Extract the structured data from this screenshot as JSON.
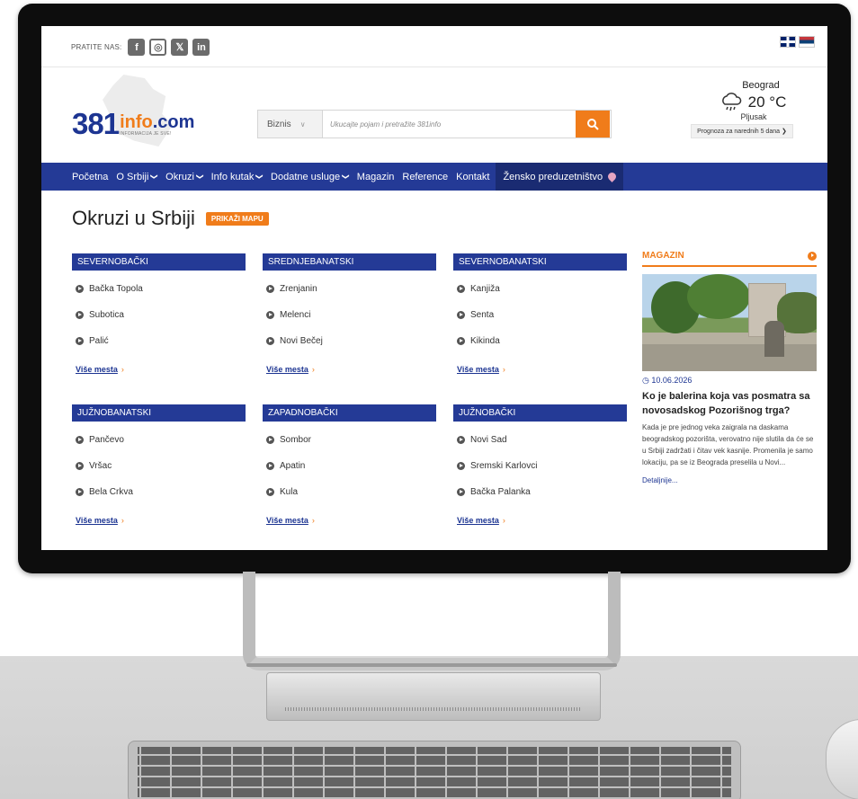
{
  "colors": {
    "brand_blue": "#243a96",
    "accent_orange": "#f07c1a",
    "nav_highlight": "#1a2b72"
  },
  "topbar": {
    "follow_label": "PRATITE NAS:",
    "social_icons": [
      "facebook-icon",
      "instagram-icon",
      "x-icon",
      "linkedin-icon"
    ],
    "languages": [
      "English",
      "Srpski"
    ]
  },
  "header": {
    "logo_number": "381",
    "logo_brand_1": "info",
    "logo_brand_2": ".com",
    "logo_tagline": "INFORMACIJA JE SVE!",
    "search_category": "Biznis",
    "search_placeholder": "Ukucajte pojam i pretražite 381info",
    "weather": {
      "city": "Beograd",
      "temperature": "20 °C",
      "description": "Pljusak",
      "forecast_label": "Prognoza za narednih 5 dana"
    }
  },
  "nav": {
    "items": [
      {
        "label": "Početna",
        "dropdown": false
      },
      {
        "label": "O Srbiji",
        "dropdown": true
      },
      {
        "label": "Okruzi",
        "dropdown": true
      },
      {
        "label": "Info kutak",
        "dropdown": true
      },
      {
        "label": "Dodatne usluge",
        "dropdown": true
      },
      {
        "label": "Magazin",
        "dropdown": false
      },
      {
        "label": "Reference",
        "dropdown": false
      },
      {
        "label": "Kontakt",
        "dropdown": false
      },
      {
        "label": "Žensko preduzetništvo",
        "dropdown": false
      }
    ]
  },
  "page": {
    "title": "Okruzi u Srbiji",
    "map_button": "PRIKAŽI MAPU",
    "more_label": "Više mesta",
    "regions": [
      {
        "name": "SEVERNOBAČKI",
        "places": [
          "Bačka Topola",
          "Subotica",
          "Palić"
        ]
      },
      {
        "name": "SREDNJEBANATSKI",
        "places": [
          "Zrenjanin",
          "Melenci",
          "Novi Bečej"
        ]
      },
      {
        "name": "SEVERNOBANATSKI",
        "places": [
          "Kanjiža",
          "Senta",
          "Kikinda"
        ]
      },
      {
        "name": "JUŽNOBANATSKI",
        "places": [
          "Pančevo",
          "Vršac",
          "Bela Crkva"
        ]
      },
      {
        "name": "ZAPADNOBAČKI",
        "places": [
          "Sombor",
          "Apatin",
          "Kula"
        ]
      },
      {
        "name": "JUŽNOBAČKI",
        "places": [
          "Novi Sad",
          "Sremski Karlovci",
          "Bačka Palanka"
        ]
      }
    ]
  },
  "magazine": {
    "title": "MAGAZIN",
    "date": "10.06.2026",
    "heading": "Ko je balerina koja vas posmatra sa novosadskog Pozorišnog trga?",
    "text": "Kada je pre jednog veka zaigrala na daskama beogradskog pozorišta, verovatno nije slutila da će se u Srbiji zadržati i čitav vek kasnije. Promenila je samo lokaciju, pa se iz Beograda preselila u Novi...",
    "link": "Detaljnije..."
  }
}
